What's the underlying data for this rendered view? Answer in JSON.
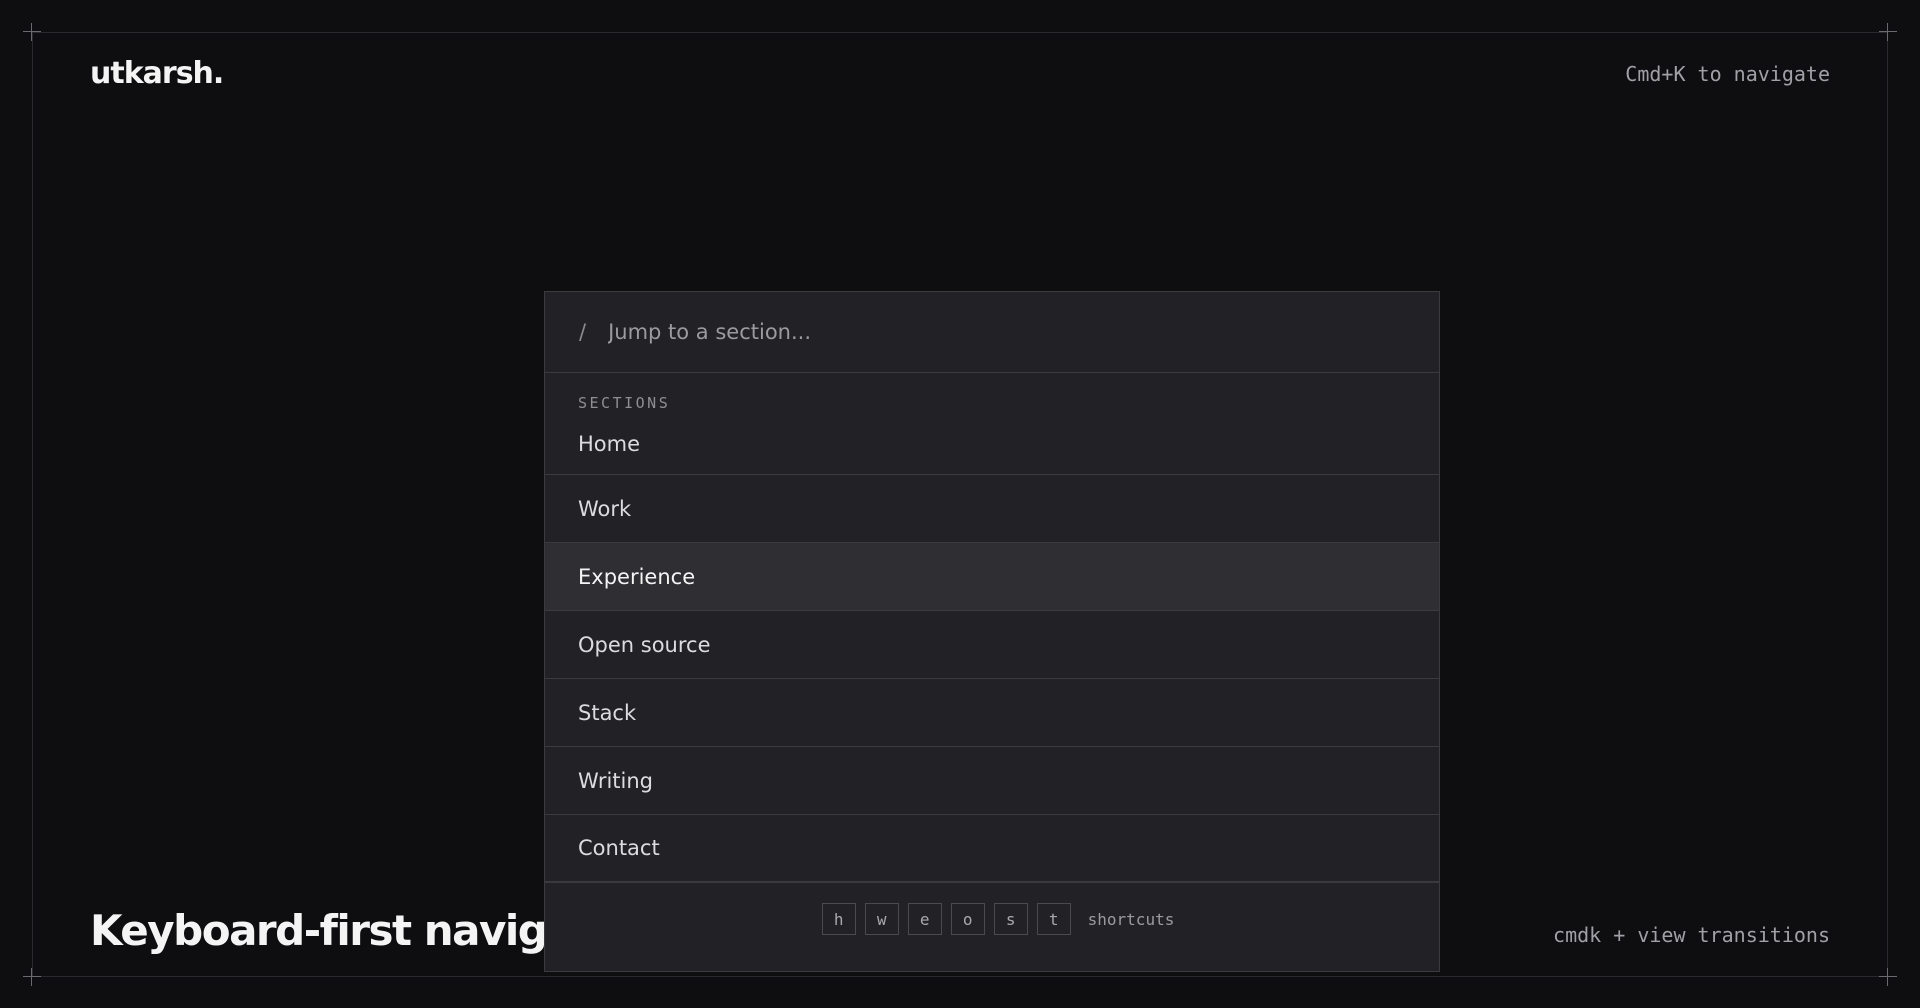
{
  "brand": {
    "logo": "utkarsh."
  },
  "header": {
    "hint": "Cmd+K to navigate"
  },
  "hero": {
    "headline": "Keyboard-first navigation",
    "tagline": "cmdk + view transitions"
  },
  "palette": {
    "search_prefix": "/",
    "search_placeholder": "Jump to a section...",
    "search_value": "",
    "section_label": "SECTIONS",
    "items": [
      {
        "label": "Home"
      },
      {
        "label": "Work"
      },
      {
        "label": "Experience"
      },
      {
        "label": "Open source"
      },
      {
        "label": "Stack"
      },
      {
        "label": "Writing"
      },
      {
        "label": "Contact"
      }
    ],
    "active_item": "Experience",
    "shortcut_keys": [
      "h",
      "w",
      "e",
      "o",
      "s",
      "t"
    ],
    "shortcut_label": "shortcuts"
  }
}
